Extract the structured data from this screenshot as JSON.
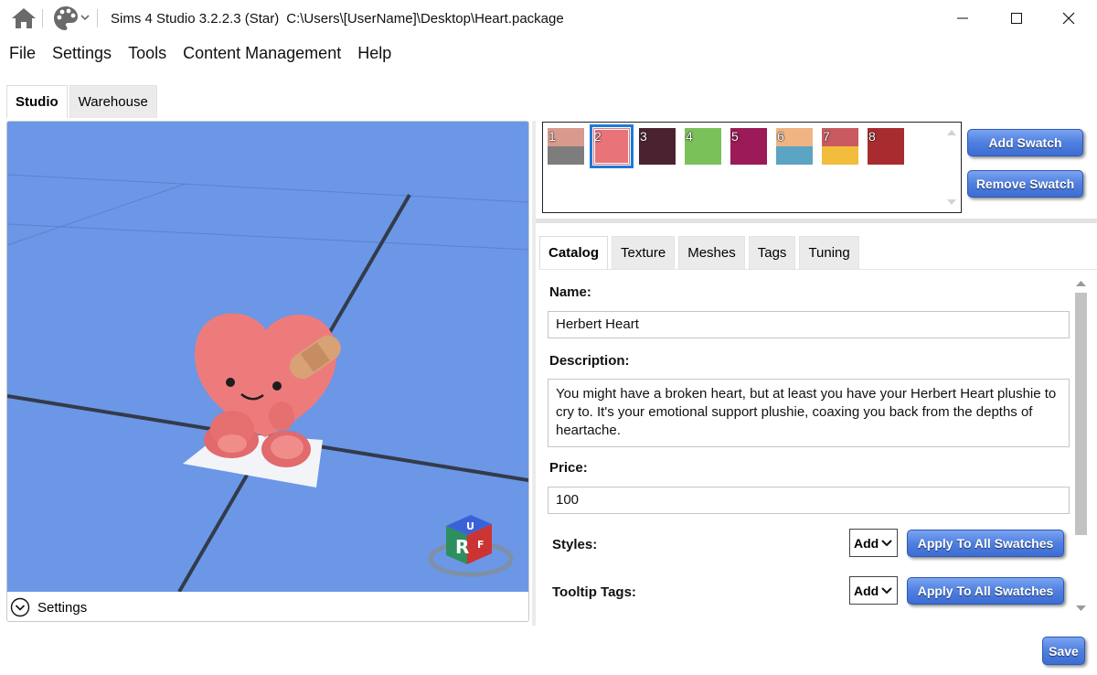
{
  "titlebar": {
    "app_title": "Sims 4 Studio 3.2.2.3 (Star)",
    "file_path": "C:\\Users\\[UserName]\\Desktop\\Heart.package"
  },
  "menu": [
    "File",
    "Settings",
    "Tools",
    "Content Management",
    "Help"
  ],
  "left_tabs": {
    "studio": "Studio",
    "warehouse": "Warehouse",
    "active": "Studio"
  },
  "viewport": {
    "settings_label": "Settings",
    "gizmo_letters": {
      "front": "R",
      "top": "U",
      "side": "F"
    },
    "background_color": "#6b97e6"
  },
  "swatches": {
    "items": [
      {
        "number": "1",
        "top": "#d79a8d",
        "bottom": "#7d7d7d"
      },
      {
        "number": "2",
        "top": "#e8747a",
        "bottom": "#e8747a",
        "selected": true
      },
      {
        "number": "3",
        "top": "#4b2330",
        "bottom": "#4b2330"
      },
      {
        "number": "4",
        "top": "#7ac15a",
        "bottom": "#7ac15a"
      },
      {
        "number": "5",
        "top": "#9c1a57",
        "bottom": "#9c1a57"
      },
      {
        "number": "6",
        "top": "#f0b483",
        "bottom": "#5ba4c3"
      },
      {
        "number": "7",
        "top": "#c95a5f",
        "bottom": "#f1bd3b"
      },
      {
        "number": "8",
        "top": "#a82c2f",
        "bottom": "#a82c2f"
      }
    ],
    "add_label": "Add Swatch",
    "remove_label": "Remove Swatch"
  },
  "right_tabs": {
    "catalog": "Catalog",
    "texture": "Texture",
    "meshes": "Meshes",
    "tags": "Tags",
    "tuning": "Tuning",
    "active": "Catalog"
  },
  "catalog": {
    "name_label": "Name:",
    "name_value": "Herbert Heart",
    "description_label": "Description:",
    "description_value": "You might have a broken heart, but at least you have your Herbert Heart plushie to cry to. It's your emotional support plushie, coaxing you back from the depths of heartache.",
    "price_label": "Price:",
    "price_value": "100",
    "styles_label": "Styles:",
    "styles_dropdown": "Add",
    "styles_apply": "Apply To All Swatches",
    "tooltip_label": "Tooltip Tags:",
    "tooltip_dropdown": "Add",
    "tooltip_apply": "Apply To All Swatches"
  },
  "footer": {
    "save_label": "Save"
  },
  "colors": {
    "accent_button": "#4f7fe0",
    "selection": "#1f7ad6"
  }
}
